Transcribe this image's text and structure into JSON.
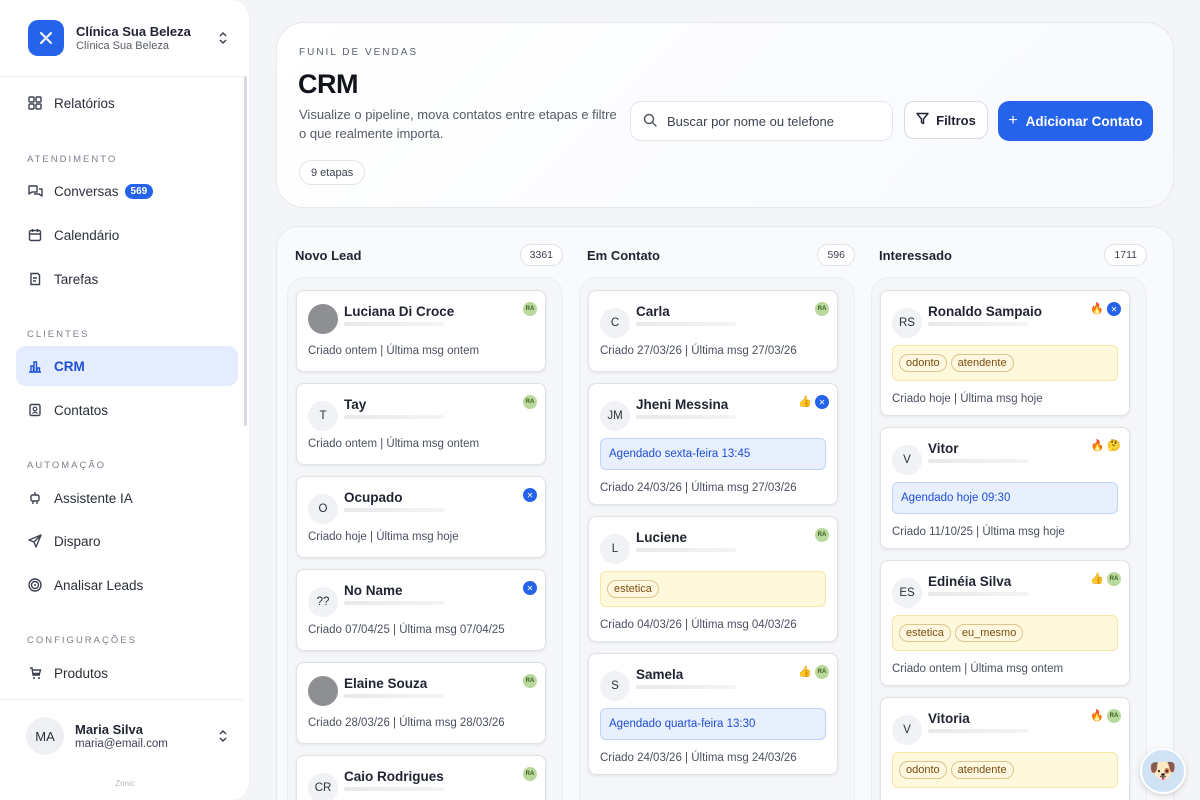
{
  "org": {
    "name": "Clínica Sua Beleza",
    "subtitle": "Clínica Sua Beleza"
  },
  "nav": {
    "reports": "Relatórios",
    "section_atendimento": "ATENDIMENTO",
    "conversations": "Conversas",
    "conversations_badge": "569",
    "calendar": "Calendário",
    "tasks": "Tarefas",
    "section_clientes": "CLIENTES",
    "crm": "CRM",
    "contacts": "Contatos",
    "section_automacao": "AUTOMAÇÃO",
    "assistant": "Assistente IA",
    "broadcast": "Disparo",
    "analyze_leads": "Analisar Leads",
    "section_config": "CONFIGURAÇÕES",
    "products": "Produtos"
  },
  "user": {
    "initials": "MA",
    "name": "Maria Silva",
    "email": "maria@email.com"
  },
  "footer": {
    "brand": "Zonic"
  },
  "header": {
    "eyebrow": "FUNIL DE VENDAS",
    "title": "CRM",
    "description": "Visualize o pipeline, mova contatos entre etapas e filtre o que realmente importa.",
    "search_placeholder": "Buscar por nome ou telefone",
    "filter_label": "Filtros",
    "add_label": "Adicionar Contato",
    "stages_pill": "9 etapas"
  },
  "colors": {
    "accent": "#2563eb",
    "active_bg": "#e4ecfd",
    "schedule_bg": "#e8f0fd",
    "tag_bg": "#fef9dc"
  },
  "columns": [
    {
      "title": "Novo Lead",
      "count": "3361",
      "cards": [
        {
          "avatar": "",
          "photo": true,
          "name": "Luciana Di Croce",
          "badges": [
            "ra"
          ],
          "meta": "Criado ontem | Última msg ontem"
        },
        {
          "avatar": "T",
          "name": "Tay",
          "badges": [
            "ra"
          ],
          "meta": "Criado ontem | Última msg ontem"
        },
        {
          "avatar": "O",
          "name": "Ocupado",
          "badges": [
            "blue"
          ],
          "meta": "Criado hoje | Última msg hoje"
        },
        {
          "avatar": "??",
          "name": "No Name",
          "badges": [
            "blue"
          ],
          "meta": "Criado 07/04/25 | Última msg 07/04/25"
        },
        {
          "avatar": "",
          "photo": true,
          "name": "Elaine Souza",
          "badges": [
            "ra"
          ],
          "meta": "Criado 28/03/26 | Última msg 28/03/26"
        },
        {
          "avatar": "CR",
          "name": "Caio Rodrigues",
          "badges": [
            "ra"
          ],
          "meta": ""
        }
      ]
    },
    {
      "title": "Em Contato",
      "count": "596",
      "cards": [
        {
          "avatar": "C",
          "name": "Carla",
          "badges": [
            "ra"
          ],
          "meta": "Criado 27/03/26 | Última msg 27/03/26"
        },
        {
          "avatar": "JM",
          "name": "Jheni Messina",
          "badges": [
            "hand",
            "blue"
          ],
          "schedule": "Agendado sexta-feira 13:45",
          "meta": "Criado 24/03/26 | Última msg 27/03/26"
        },
        {
          "avatar": "L",
          "name": "Luciene",
          "badges": [
            "ra"
          ],
          "tags": [
            "estetica"
          ],
          "meta": "Criado 04/03/26 | Última msg 04/03/26"
        },
        {
          "avatar": "S",
          "name": "Samela",
          "badges": [
            "hand",
            "ra"
          ],
          "schedule": "Agendado quarta-feira 13:30",
          "meta": "Criado 24/03/26 | Última msg 24/03/26"
        }
      ]
    },
    {
      "title": "Interessado",
      "count": "1711",
      "cards": [
        {
          "avatar": "RS",
          "name": "Ronaldo Sampaio",
          "badges": [
            "fire",
            "blue"
          ],
          "tags": [
            "odonto",
            "atendente"
          ],
          "meta": "Criado hoje | Última msg hoje"
        },
        {
          "avatar": "V",
          "name": "Vitor",
          "badges": [
            "fire",
            "face"
          ],
          "schedule": "Agendado hoje 09:30",
          "meta": "Criado 11/10/25 | Última msg hoje"
        },
        {
          "avatar": "ES",
          "name": "Edinéia Silva",
          "badges": [
            "hand",
            "ra"
          ],
          "tags": [
            "estetica",
            "eu_mesmo"
          ],
          "meta": "Criado ontem | Última msg ontem"
        },
        {
          "avatar": "V",
          "name": "Vitoria",
          "badges": [
            "fire",
            "ra"
          ],
          "tags": [
            "odonto",
            "atendente"
          ],
          "meta": ""
        }
      ]
    }
  ]
}
